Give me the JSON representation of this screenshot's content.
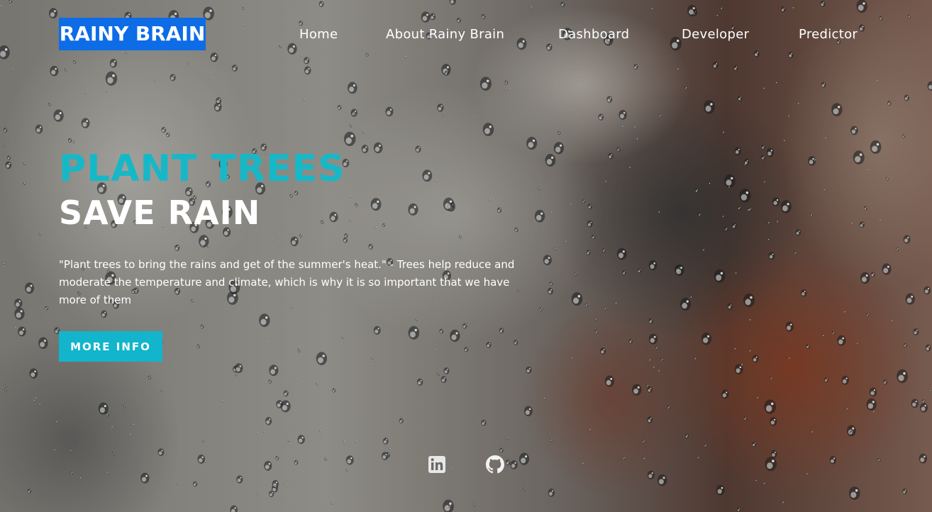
{
  "brand": {
    "logo_text": "RAINY BRAIN",
    "logo_color": "#0d6ce6"
  },
  "nav": {
    "items": [
      {
        "label": "Home"
      },
      {
        "label": "About Rainy Brain"
      },
      {
        "label": "Dashboard"
      },
      {
        "label": "Developer"
      },
      {
        "label": "Predictor"
      }
    ]
  },
  "hero": {
    "headline_accent": "PLANT TREES",
    "headline_main": "SAVE RAIN",
    "accent_color": "#16b8c8",
    "quote": "\"Plant trees to bring the rains and get of the summer's heat.\" - Trees help reduce and moderate the temperature and climate, which is why it is so important that we have more of them",
    "cta_label": "MORE INFO",
    "cta_color": "#12b5cb",
    "background": "rain-drops-on-glass"
  },
  "social": {
    "linkedin_icon": "linkedin-icon",
    "github_icon": "github-icon"
  }
}
